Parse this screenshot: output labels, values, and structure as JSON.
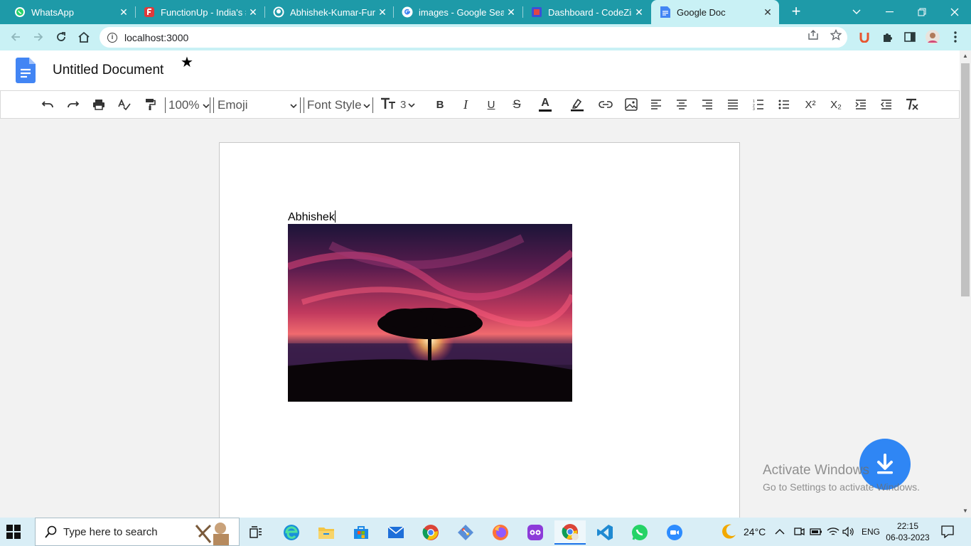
{
  "browser": {
    "tabs": [
      {
        "title": "WhatsApp",
        "close": "✕",
        "icon": "whatsapp-icon"
      },
      {
        "title": "FunctionUp - India's #",
        "close": "✕",
        "icon": "functionup-icon"
      },
      {
        "title": "Abhishek-Kumar-Func",
        "close": "✕",
        "icon": "github-icon"
      },
      {
        "title": "images - Google Searc",
        "close": "✕",
        "icon": "google-icon"
      },
      {
        "title": "Dashboard - CodeZinc",
        "close": "✕",
        "icon": "codezinc-icon"
      },
      {
        "title": "Google Doc",
        "close": "✕",
        "icon": "docs-icon"
      }
    ],
    "new_tab": "+",
    "url": "localhost:3000"
  },
  "app": {
    "doc_title": "Untitled Document",
    "star": "★",
    "zoom": "100%",
    "font_family": "Emoji",
    "font_style": "Font Style",
    "font_size": "3",
    "bold": "B",
    "italic": "I",
    "underline": "U",
    "strikethrough": "S",
    "text_color": "A",
    "superscript": "X²",
    "subscript": "X₂"
  },
  "document": {
    "text": "Abhishek"
  },
  "watermark": {
    "line1": "Activate Windows",
    "line2": "Go to Settings to activate Windows."
  },
  "taskbar": {
    "search_placeholder": "Type here to search",
    "temperature": "24°C",
    "language": "ENG",
    "time": "22:15",
    "date": "06-03-2023"
  },
  "colors": {
    "tab_strip": "#1e9aa8",
    "address_bar": "#c9f1f5",
    "fab": "#2f86f4"
  }
}
